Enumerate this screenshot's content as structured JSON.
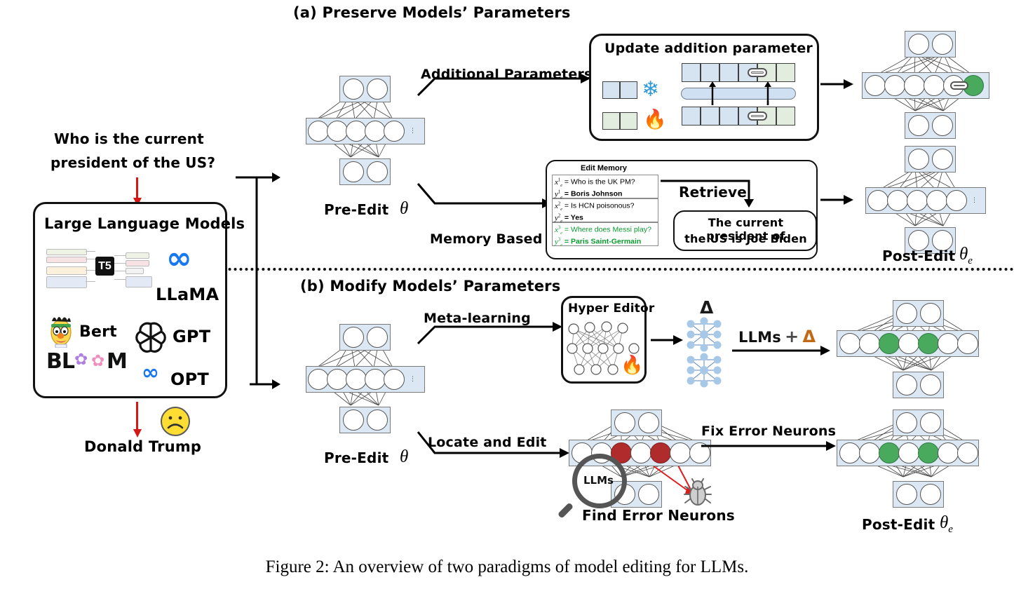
{
  "figure": {
    "caption": "Figure 2: An overview of two paradigms of model editing for LLMs."
  },
  "panels": {
    "a": {
      "title": "(a) Preserve Models’ Parameters"
    },
    "b": {
      "title": "(b) Modify Models’ Parameters"
    }
  },
  "left": {
    "question": "Who is the current president of the US?",
    "question_line1": "Who is the current",
    "question_line2": "president of the US?",
    "box_title": "Large Language Models",
    "models": [
      {
        "name": "T5",
        "label": "T5"
      },
      {
        "name": "llama",
        "label": "LLaMA"
      },
      {
        "name": "bert",
        "label": "Bert"
      },
      {
        "name": "gpt",
        "label": "GPT"
      },
      {
        "name": "bloom",
        "label": "BLOOM"
      },
      {
        "name": "opt",
        "label": "OPT"
      }
    ],
    "answer": "Donald Trump",
    "answer_face": "sad-face"
  },
  "panel_a": {
    "pre_edit_label": "Pre-Edit",
    "pre_edit_theta": "θ",
    "branches": [
      {
        "label": "Additional Parameters"
      },
      {
        "label": "Memory Based"
      }
    ],
    "addition_box": {
      "title": "Update addition parameter",
      "legend": [
        {
          "state": "frozen",
          "icon": "snowflake-icon",
          "color": "#d6e4f2"
        },
        {
          "state": "trainable",
          "icon": "fire-icon",
          "color": "#e2ecdf"
        }
      ]
    },
    "memory_box": {
      "title": "Edit Memory",
      "rows": [
        {
          "x_key": "x",
          "x_sup": "1",
          "x_sub": "e",
          "x_text": "= Who is the UK PM?",
          "y_key": "y",
          "y_sup": "1",
          "y_sub": "e",
          "y_text": "= Boris Johnson",
          "highlight": false
        },
        {
          "x_key": "x",
          "x_sup": "2",
          "x_sub": "e",
          "x_text": "= Is HCN poisonous?",
          "y_key": "y",
          "y_sup": "2",
          "y_sub": "e",
          "y_text": "= Yes",
          "highlight": false
        },
        {
          "x_key": "x",
          "x_sup": "3",
          "x_sub": "e",
          "x_text": "= Where does Messi play?",
          "y_key": "y",
          "y_sup": "3",
          "y_sub": "e",
          "y_text": "= Paris Saint-Germain",
          "highlight": true
        }
      ],
      "retrieve_label": "Retrieve",
      "retrieved_line1": "The current president of",
      "retrieved_line2": "the US is Joe Biden"
    },
    "post_edit_label": "Post-Edit",
    "post_edit_theta": "θ",
    "post_edit_sub": "e"
  },
  "panel_b": {
    "pre_edit_label": "Pre-Edit",
    "pre_edit_theta": "θ",
    "branches": [
      {
        "label": "Meta-learning"
      },
      {
        "label": "Locate and Edit"
      }
    ],
    "hyper_editor": {
      "title": "Hyper Editor",
      "icon": "fire-icon"
    },
    "delta_symbol": "Δ",
    "combine_label_llms": "LLMs",
    "combine_label_plus": "+",
    "combine_label_delta": "Δ",
    "locate": {
      "magnifier_text": "LLMs",
      "caption": "Find Error Neurons",
      "bug_icon": "bug-icon"
    },
    "fix_label": "Fix Error Neurons",
    "post_edit_label": "Post-Edit",
    "post_edit_theta": "θ",
    "post_edit_sub": "e"
  },
  "colors": {
    "layer_fill": "#dbe7f3",
    "layer_stroke": "#7a7a7a",
    "edited_neuron_green": "#49a95c",
    "error_neuron_red": "#b02b2b",
    "arrow_red": "#d71616",
    "frozen_blue": "#d6e4f2",
    "trainable_green": "#e2ecdf",
    "meta_blue": "#1877f2",
    "memory_green": "#0a9a2e"
  }
}
